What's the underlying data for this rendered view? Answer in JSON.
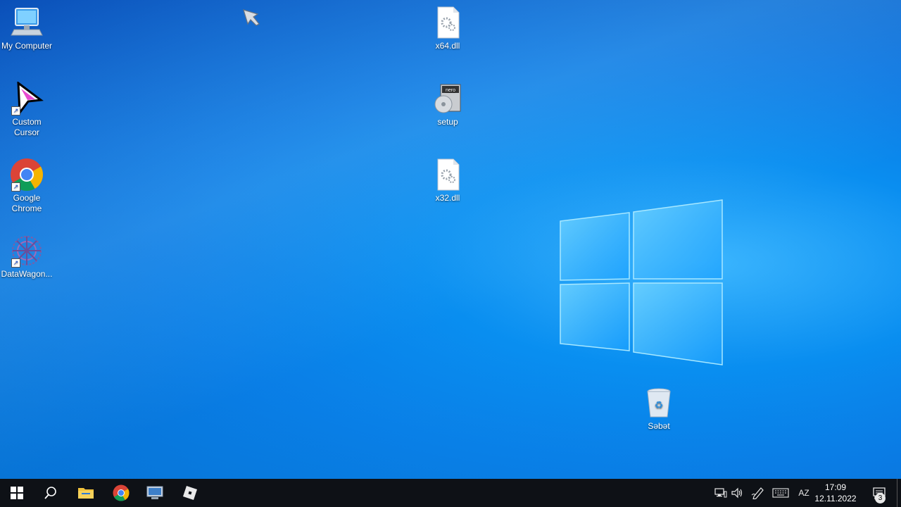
{
  "desktop": {
    "icons": {
      "my_computer": "My Computer",
      "custom_cursor": "Custom Cursor",
      "google_chrome": "Google Chrome",
      "datawagon": "DataWagon...",
      "x64": "x64.dll",
      "setup": "setup",
      "x32": "x32.dll",
      "recycle_bin": "Səbət"
    }
  },
  "taskbar": {
    "language": "AZ",
    "time": "17:09",
    "date": "12.11.2022",
    "notification_count": "3"
  },
  "colors": {
    "taskbar_bg": "#0e1116",
    "desktop_blue": "#0a8ef0"
  },
  "icon_names": [
    "computer-icon",
    "cursor-icon",
    "chrome-icon",
    "datawagon-icon",
    "dll-icon",
    "nero-setup-icon",
    "recycle-bin-icon",
    "windows-start-icon",
    "search-icon",
    "file-explorer-icon",
    "network-icon",
    "volume-icon",
    "pen-icon",
    "keyboard-icon",
    "notification-icon"
  ]
}
